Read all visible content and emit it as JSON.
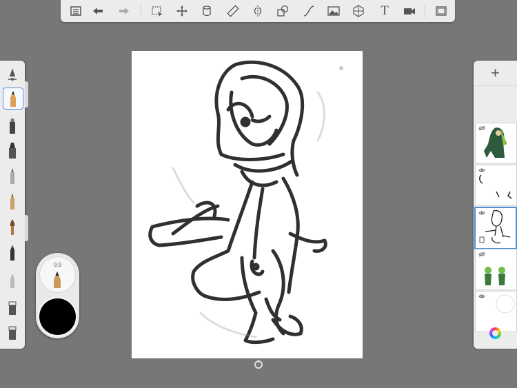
{
  "toolbar": {
    "buttons": [
      {
        "name": "gallery-button",
        "icon": "list-icon"
      },
      {
        "name": "undo-button",
        "icon": "undo-arrow-icon"
      },
      {
        "name": "redo-button",
        "icon": "redo-arrow-icon"
      },
      {
        "name": "selection-button",
        "icon": "selection-icon"
      },
      {
        "name": "transform-button",
        "icon": "move-icon"
      },
      {
        "name": "fill-button",
        "icon": "bucket-icon"
      },
      {
        "name": "ruler-button",
        "icon": "ruler-icon"
      },
      {
        "name": "symmetry-button",
        "icon": "symmetry-icon"
      },
      {
        "name": "shape-button",
        "icon": "shapes-icon"
      },
      {
        "name": "curve-button",
        "icon": "curve-icon"
      },
      {
        "name": "image-button",
        "icon": "image-icon"
      },
      {
        "name": "perspective-button",
        "icon": "perspective-grid-icon"
      },
      {
        "name": "text-button",
        "icon": "text-icon",
        "label": "T"
      },
      {
        "name": "record-button",
        "icon": "video-icon"
      },
      {
        "name": "fullscreen-button",
        "icon": "fullscreen-icon"
      }
    ]
  },
  "brushes": [
    {
      "name": "brush-settings",
      "icon": "brush-settings-icon"
    },
    {
      "name": "pencil",
      "icon": "pencil-icon",
      "selected": true
    },
    {
      "name": "marker",
      "icon": "marker-icon"
    },
    {
      "name": "chisel-marker",
      "icon": "chisel-icon"
    },
    {
      "name": "airbrush",
      "icon": "airbrush-icon"
    },
    {
      "name": "ballpoint",
      "icon": "pen-icon"
    },
    {
      "name": "paintbrush",
      "icon": "paintbrush-icon"
    },
    {
      "name": "ink-pen",
      "icon": "ink-icon"
    },
    {
      "name": "smudge",
      "icon": "smudge-icon"
    },
    {
      "name": "eraser-hard",
      "icon": "eraser-icon"
    },
    {
      "name": "eraser-soft",
      "icon": "eraser-soft-icon"
    }
  ],
  "puck": {
    "size_label": "9.9",
    "color": "#000000"
  },
  "layers": {
    "add_label": "+",
    "items": [
      {
        "name": "layer-1",
        "visible": false
      },
      {
        "name": "layer-2",
        "visible": true
      },
      {
        "name": "layer-3",
        "visible": true,
        "selected": true
      },
      {
        "name": "layer-4",
        "visible": false
      },
      {
        "name": "layer-5",
        "visible": true
      }
    ]
  },
  "colors": {
    "accent": "#4a90d9",
    "background": "#777777",
    "panel": "#ececec"
  }
}
